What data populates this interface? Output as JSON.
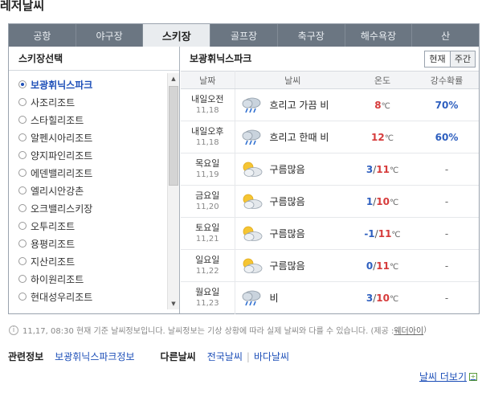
{
  "page": {
    "title": "레저날씨"
  },
  "tabs": [
    "공항",
    "야구장",
    "스키장",
    "골프장",
    "축구장",
    "해수욕장",
    "산"
  ],
  "active_tab": "스키장",
  "sidebar": {
    "header": "스키장선택",
    "selected": "보광휘닉스파크",
    "items": [
      "보광휘닉스파크",
      "사조리조트",
      "스타힐리조트",
      "알펜시아리조트",
      "양지파인리조트",
      "에덴밸리리조트",
      "엘리시안강촌",
      "오크밸리스키장",
      "오투리조트",
      "용평리조트",
      "지산리조트",
      "하이원리조트",
      "현대성우리조트"
    ]
  },
  "main": {
    "title": "보광휘닉스파크",
    "toggle": {
      "current": "현재",
      "weekly": "주간",
      "active": "주간"
    },
    "columns": {
      "date": "날짜",
      "weather": "날씨",
      "temp": "온도",
      "rain": "강수확률"
    },
    "unit": "℃",
    "rows": [
      {
        "day": "내일오전",
        "date": "11,18",
        "icon": "rain-cloud-icon",
        "weather": "흐리고 가끔 비",
        "low": "",
        "high": "8",
        "rain": "70%"
      },
      {
        "day": "내일오후",
        "date": "11,18",
        "icon": "rain-cloud-icon",
        "weather": "흐리고 한때 비",
        "low": "",
        "high": "12",
        "rain": "60%"
      },
      {
        "day": "목요일",
        "date": "11,19",
        "icon": "sun-cloud-icon",
        "weather": "구름많음",
        "low": "3",
        "high": "11",
        "rain": "-"
      },
      {
        "day": "금요일",
        "date": "11,20",
        "icon": "sun-cloud-icon",
        "weather": "구름많음",
        "low": "1",
        "high": "10",
        "rain": "-"
      },
      {
        "day": "토요일",
        "date": "11,21",
        "icon": "sun-cloud-icon",
        "weather": "구름많음",
        "low": "-1",
        "high": "11",
        "rain": "-"
      },
      {
        "day": "일요일",
        "date": "11,22",
        "icon": "sun-cloud-icon",
        "weather": "구름많음",
        "low": "0",
        "high": "11",
        "rain": "-"
      },
      {
        "day": "월요일",
        "date": "11,23",
        "icon": "rain-cloud-icon",
        "weather": "비",
        "low": "3",
        "high": "10",
        "rain": "-"
      }
    ]
  },
  "notice": {
    "text": "11,17, 08:30 현재 기준 날씨정보입니다. 날씨정보는 기상 상황에 따라 실제 날씨와 다를 수 있습니다. (제공 : ",
    "provider": "웨더아이",
    "close": ")"
  },
  "related": {
    "title": "관련정보",
    "link": "보광휘닉스파크정보",
    "title2": "다른날씨",
    "links": [
      "전국날씨",
      "바다날씨"
    ]
  },
  "more": {
    "label": "날씨 더보기",
    "icon": "plus-icon"
  },
  "colors": {
    "tab_bar": "#6b7682",
    "link": "#1d4fb8",
    "temp_low": "#2e5fbf",
    "temp_high": "#d63b3b"
  }
}
